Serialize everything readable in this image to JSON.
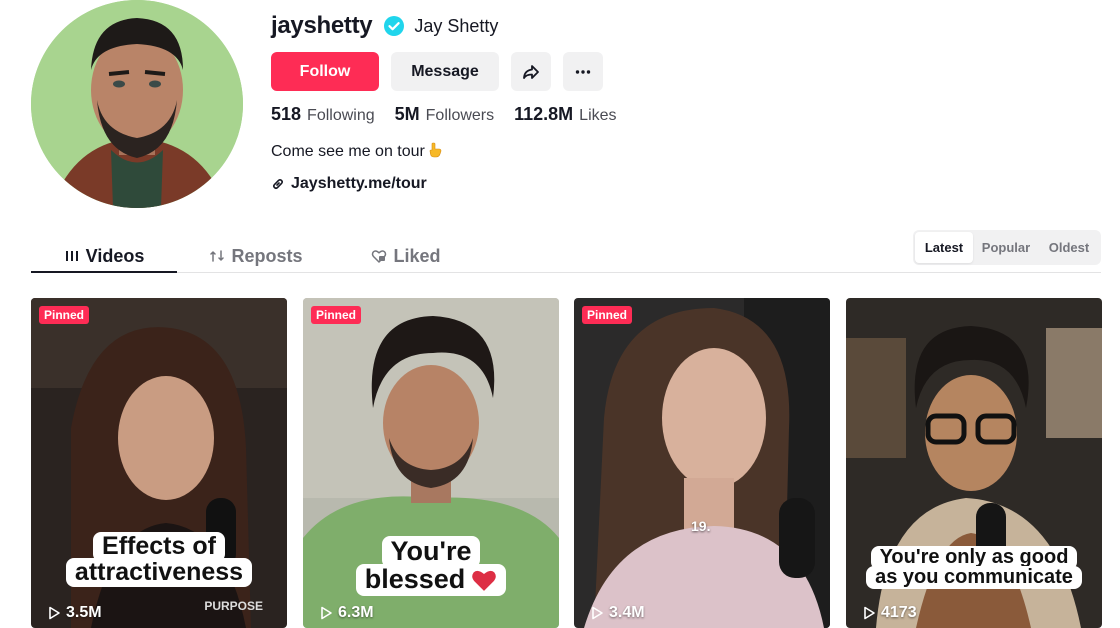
{
  "profile": {
    "username": "jayshetty",
    "nickname": "Jay Shetty",
    "verified_icon": "verified-badge-icon",
    "follow_label": "Follow",
    "message_label": "Message",
    "share_icon": "share-icon",
    "more_icon": "more-icon",
    "stats": {
      "following_count": "518",
      "following_label": "Following",
      "followers_count": "5M",
      "followers_label": "Followers",
      "likes_count": "112.8M",
      "likes_label": "Likes"
    },
    "bio": "Come see me on tour",
    "bio_emoji": "pointing-down-emoji",
    "link": "Jayshetty.me/tour",
    "link_icon": "link-icon"
  },
  "tabs": {
    "videos": "Videos",
    "reposts": "Reposts",
    "liked": "Liked",
    "active": "Videos"
  },
  "sort": {
    "latest": "Latest",
    "popular": "Popular",
    "oldest": "Oldest",
    "active": "Latest"
  },
  "colors": {
    "accent": "#fe2c55",
    "verified": "#20d5ec",
    "text": "#161823",
    "muted": "#75767d"
  },
  "videos": [
    {
      "pinned": "Pinned",
      "views": "3.5M",
      "caption": [
        "Effects of",
        "attractiveness"
      ]
    },
    {
      "pinned": "Pinned",
      "views": "6.3M",
      "caption": [
        "You're",
        "blessed"
      ]
    },
    {
      "pinned": "Pinned",
      "views": "3.4M",
      "overlay_text": "19."
    },
    {
      "views": "4173",
      "caption": [
        "You're only as good",
        "as you communicate"
      ]
    }
  ]
}
